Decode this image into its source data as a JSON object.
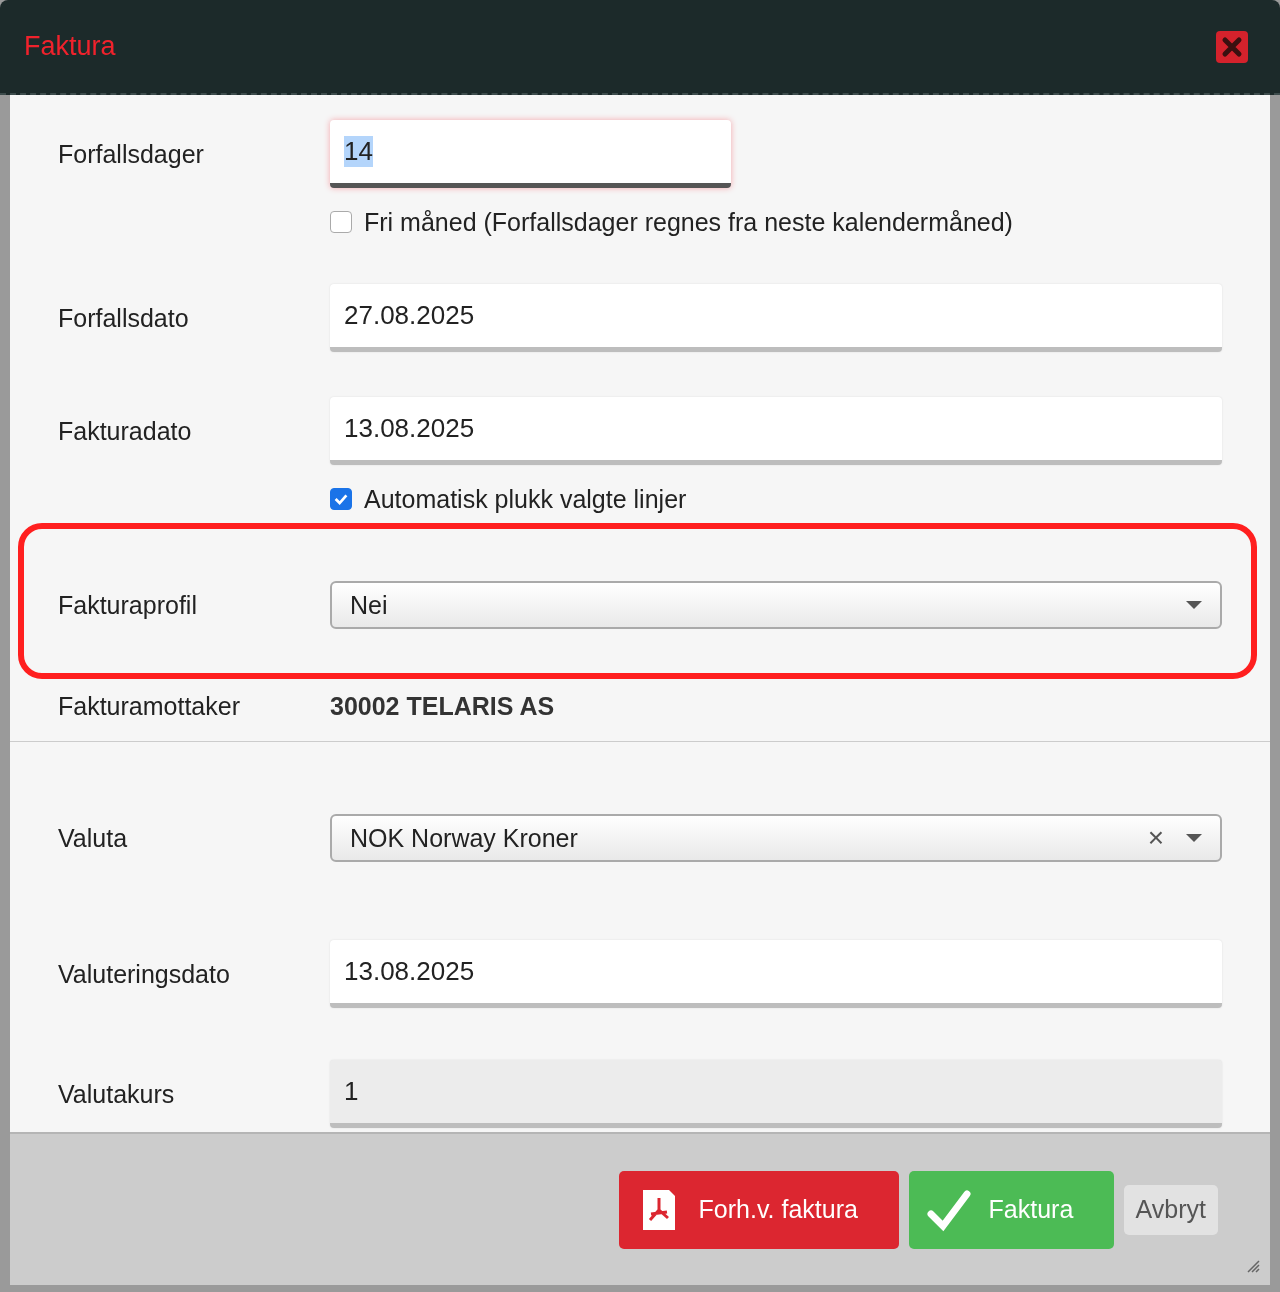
{
  "window": {
    "title": "Faktura"
  },
  "rows": [
    {
      "kind": "text",
      "label": "Forfallsdager",
      "value": "14",
      "focused": true,
      "short": true,
      "disabled": false
    },
    {
      "kind": "checkbox",
      "label": "Fri måned (Forfallsdager regnes fra neste kalendermåned)",
      "checked": false
    },
    {
      "kind": "text",
      "label": "Forfallsdato",
      "value": "27.08.2025",
      "focused": false,
      "short": false,
      "disabled": false
    },
    {
      "kind": "text",
      "label": "Fakturadato",
      "value": "13.08.2025",
      "focused": false,
      "short": false,
      "disabled": false
    },
    {
      "kind": "checkbox",
      "label": "Automatisk plukk valgte linjer",
      "checked": true
    },
    {
      "kind": "select",
      "label": "Fakturaprofil",
      "value": "Nei",
      "highlighted": true
    },
    {
      "kind": "static",
      "label": "Fakturamottaker",
      "value": "30002 TELARIS AS"
    },
    {
      "kind": "divider"
    },
    {
      "kind": "select",
      "label": "Valuta",
      "value": "NOK Norway Kroner",
      "clear": "×",
      "highlighted": false
    },
    {
      "kind": "text",
      "label": "Valuteringsdato",
      "value": "13.08.2025",
      "focused": false,
      "short": false,
      "disabled": false
    },
    {
      "kind": "text",
      "label": "Valutakurs",
      "value": "1",
      "focused": false,
      "short": false,
      "disabled": true
    }
  ],
  "buttons": [
    {
      "kind": "pdf",
      "label": "Forh.v. faktura"
    },
    {
      "kind": "confirm",
      "label": "Faktura"
    },
    {
      "kind": "cancel",
      "label": "Avbryt"
    }
  ]
}
